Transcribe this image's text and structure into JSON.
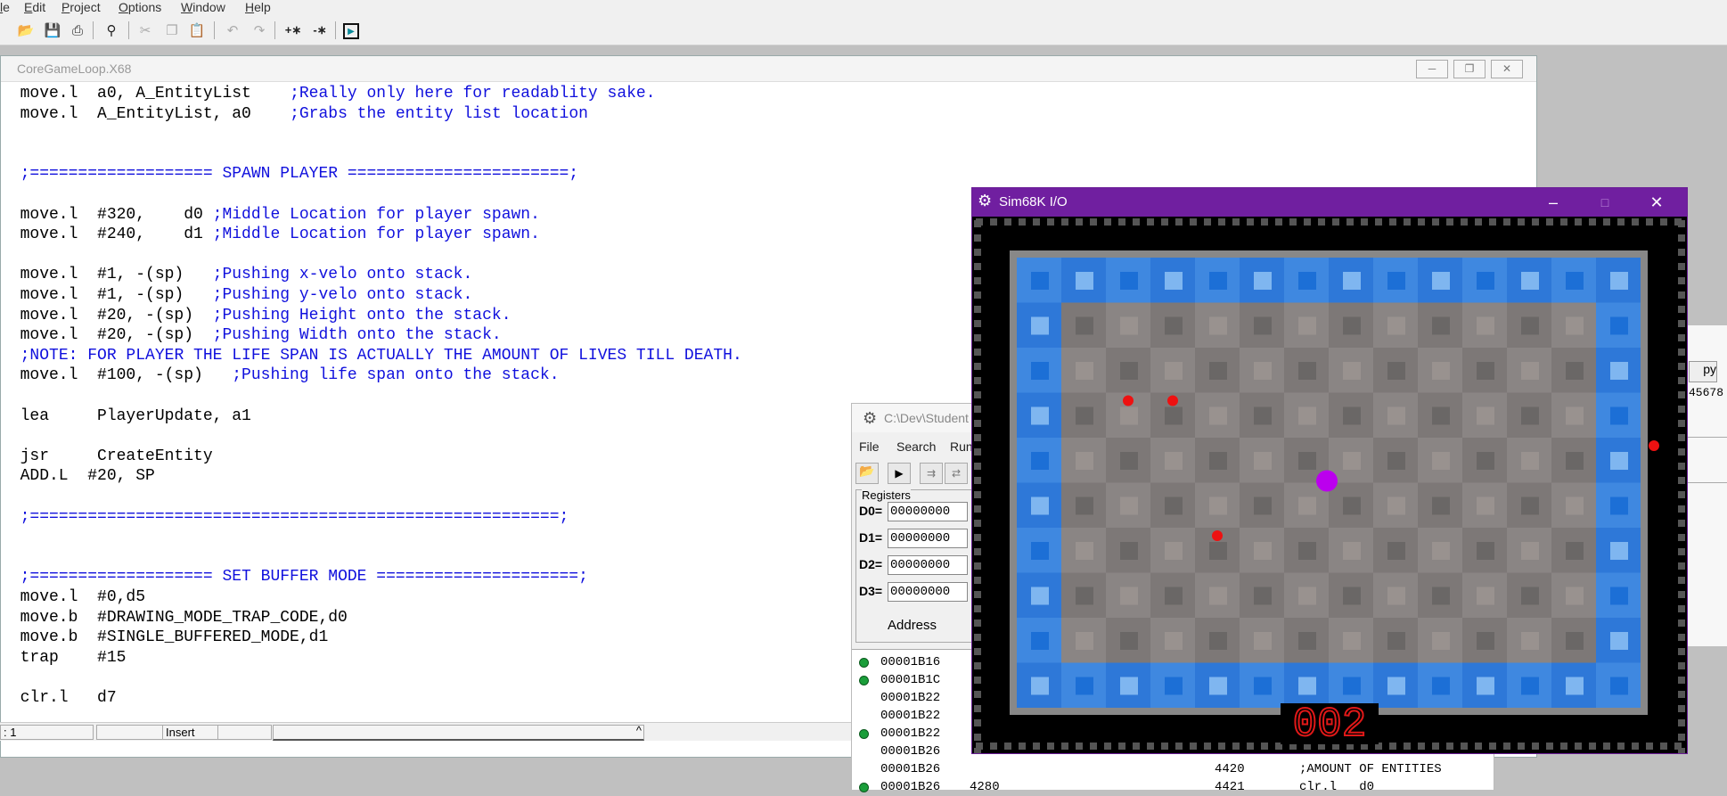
{
  "menu": [
    "le",
    "Edit",
    "Project",
    "Options",
    "Window",
    "Help"
  ],
  "toolbar": {
    "icons": [
      "open-icon",
      "save-icon",
      "print-icon",
      "find-icon",
      "cut-icon",
      "copy-icon",
      "paste-icon",
      "undo-icon",
      "redo-icon",
      "expand-icon",
      "collapse-icon",
      "run-icon"
    ],
    "expand_label": "+∗",
    "collapse_label": "-∗"
  },
  "editor": {
    "title": "CoreGameLoop.X68",
    "lines": [
      {
        "code": "  move.l  a0, A_EntityList    ",
        "comment": ";Really only here for readablity sake."
      },
      {
        "code": "  move.l  A_EntityList, a0    ",
        "comment": ";Grabs the entity list location"
      },
      {
        "code": "",
        "comment": ""
      },
      {
        "code": "",
        "comment": ""
      },
      {
        "code": "  ",
        "comment": ";=================== SPAWN PLAYER =======================;"
      },
      {
        "code": "",
        "comment": ""
      },
      {
        "code": "  move.l  #320,    d0 ",
        "comment": ";Middle Location for player spawn."
      },
      {
        "code": "  move.l  #240,    d1 ",
        "comment": ";Middle Location for player spawn."
      },
      {
        "code": "",
        "comment": ""
      },
      {
        "code": "  move.l  #1, -(sp)   ",
        "comment": ";Pushing x-velo onto stack."
      },
      {
        "code": "  move.l  #1, -(sp)   ",
        "comment": ";Pushing y-velo onto stack."
      },
      {
        "code": "  move.l  #20, -(sp)  ",
        "comment": ";Pushing Height onto the stack."
      },
      {
        "code": "  move.l  #20, -(sp)  ",
        "comment": ";Pushing Width onto the stack."
      },
      {
        "code": "  ",
        "comment": ";NOTE: FOR PLAYER THE LIFE SPAN IS ACTUALLY THE AMOUNT OF LIVES TILL DEATH."
      },
      {
        "code": "  move.l  #100, -(sp)   ",
        "comment": ";Pushing life span onto the stack."
      },
      {
        "code": "",
        "comment": ""
      },
      {
        "code": "  lea     PlayerUpdate, a1",
        "comment": ""
      },
      {
        "code": "",
        "comment": ""
      },
      {
        "code": "  jsr     CreateEntity",
        "comment": ""
      },
      {
        "code": "  ADD.L  #20, SP",
        "comment": ""
      },
      {
        "code": "",
        "comment": ""
      },
      {
        "code": "  ",
        "comment": ";=======================================================;"
      },
      {
        "code": "",
        "comment": ""
      },
      {
        "code": "",
        "comment": ""
      },
      {
        "code": "  ",
        "comment": ";=================== SET BUFFER MODE =====================;"
      },
      {
        "code": "  move.l  #0,d5",
        "comment": ""
      },
      {
        "code": "  move.b  #DRAWING_MODE_TRAP_CODE,d0",
        "comment": ""
      },
      {
        "code": "  move.b  #SINGLE_BUFFERED_MODE,d1",
        "comment": ""
      },
      {
        "code": "  trap    #15",
        "comment": ""
      },
      {
        "code": "",
        "comment": ""
      },
      {
        "code": "  clr.l   d7",
        "comment": ""
      }
    ],
    "status": {
      "line": ": 1",
      "mode": "Insert",
      "caret": "^"
    }
  },
  "sim": {
    "title": "C:\\Dev\\Student",
    "menu": [
      "File",
      "Search",
      "Run"
    ],
    "registers_label": "Registers",
    "registers": [
      {
        "name": "D0=",
        "value": "00000000"
      },
      {
        "name": "D1=",
        "value": "00000000"
      },
      {
        "name": "D2=",
        "value": "00000000"
      },
      {
        "name": "D3=",
        "value": "00000000"
      }
    ],
    "address_label": "Address",
    "listing": [
      {
        "addr": "00001B16",
        "bp": true,
        "code": "",
        "line": "",
        "src": ""
      },
      {
        "addr": "00001B1C",
        "bp": true,
        "code": "",
        "line": "",
        "src": ""
      },
      {
        "addr": "00001B22",
        "bp": false,
        "code": "",
        "line": "",
        "src": ""
      },
      {
        "addr": "00001B22",
        "bp": false,
        "code": "",
        "line": "",
        "src": ""
      },
      {
        "addr": "00001B22",
        "bp": true,
        "code": "",
        "line": "",
        "src": ""
      },
      {
        "addr": "00001B26",
        "bp": false,
        "code": "",
        "line": "",
        "src": ""
      },
      {
        "addr": "00001B26",
        "bp": false,
        "code": "",
        "line": "4420",
        "src": ";AMOUNT OF ENTITIES"
      },
      {
        "addr": "00001B26",
        "bp": true,
        "code": "4280",
        "line": "4421",
        "src": "clr.l   d0"
      }
    ],
    "right_frag": {
      "btn": "py",
      "num": "45678"
    }
  },
  "io": {
    "title": "Sim68K I/O",
    "score": "002",
    "colors": {
      "title": "#701fa0",
      "blue_dark": "#1c6fd6",
      "blue_light": "#63a5ec",
      "gray_a": "#6e6e6e",
      "gray_b": "#8a8584",
      "enemy": "#ee1111",
      "player": "#bb00ee"
    },
    "enemies": [
      [
        2,
        3
      ],
      [
        3,
        3
      ],
      [
        4,
        6
      ],
      [
        13.8,
        4
      ]
    ],
    "player": [
      7,
      5
    ]
  }
}
